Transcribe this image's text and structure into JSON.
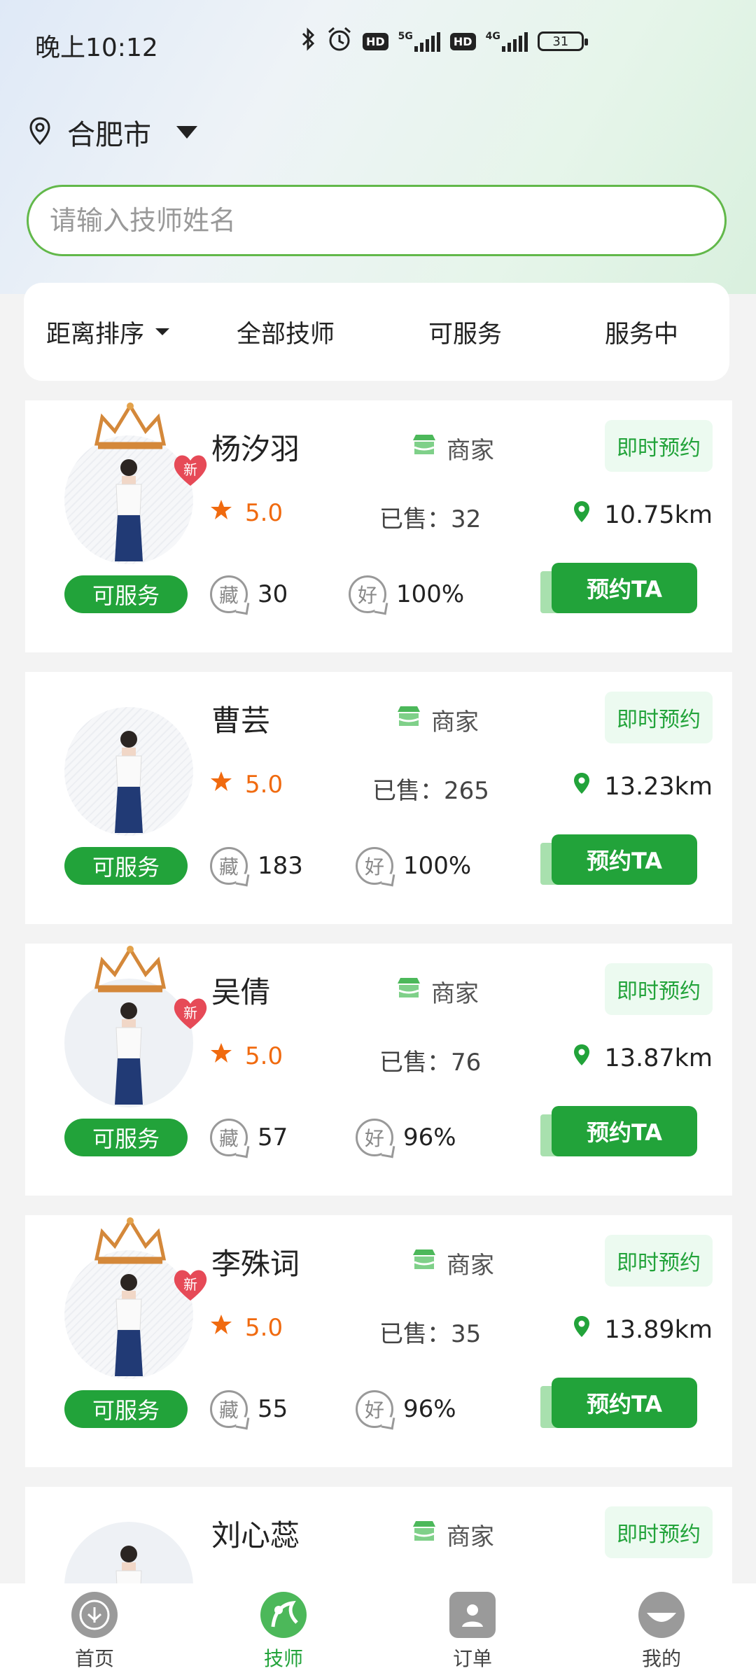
{
  "status_bar": {
    "time": "晚上10:12",
    "battery": "31"
  },
  "location": {
    "city": "合肥市"
  },
  "search": {
    "placeholder": "请输入技师姓名"
  },
  "filters": [
    {
      "label": "距离排序"
    },
    {
      "label": "全部技师"
    },
    {
      "label": "可服务"
    },
    {
      "label": "服务中"
    }
  ],
  "common": {
    "merchant": "商家",
    "instant": "即时预约",
    "book": "预约TA",
    "available": "可服务",
    "sold_prefix": "已售：",
    "fav_icon_char": "藏",
    "good_icon_char": "好",
    "new_char": "新"
  },
  "technicians": [
    {
      "name": "杨汐羽",
      "rating": "5.0",
      "sold": "32",
      "distance": "10.75km",
      "favorites": "30",
      "good_rate": "100%",
      "is_new": true
    },
    {
      "name": "曹芸",
      "rating": "5.0",
      "sold": "265",
      "distance": "13.23km",
      "favorites": "183",
      "good_rate": "100%",
      "is_new": false
    },
    {
      "name": "吴倩",
      "rating": "5.0",
      "sold": "76",
      "distance": "13.87km",
      "favorites": "57",
      "good_rate": "96%",
      "is_new": true
    },
    {
      "name": "李殊词",
      "rating": "5.0",
      "sold": "35",
      "distance": "13.89km",
      "favorites": "55",
      "good_rate": "96%",
      "is_new": true
    },
    {
      "name": "刘心蕊",
      "rating": "",
      "sold": "",
      "distance": "",
      "favorites": "",
      "good_rate": "",
      "is_new": false
    }
  ],
  "tabbar": [
    {
      "label": "首页",
      "icon": "home-icon"
    },
    {
      "label": "技师",
      "icon": "technician-icon"
    },
    {
      "label": "订单",
      "icon": "order-icon"
    },
    {
      "label": "我的",
      "icon": "profile-icon"
    }
  ],
  "colors": {
    "brand_green": "#22a33a",
    "rating_orange": "#f06a0f",
    "new_red": "#e64a57"
  }
}
